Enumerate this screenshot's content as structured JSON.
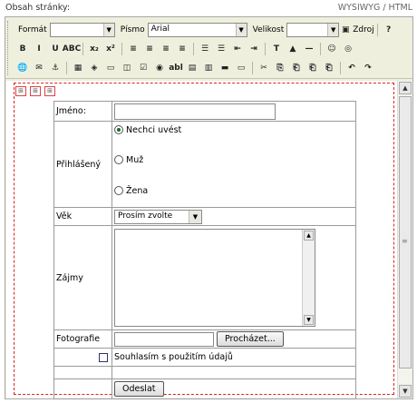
{
  "header": {
    "label": "Obsah stránky:",
    "mode": "WYSIWYG / HTML"
  },
  "toolbar": {
    "format_label": "Formát",
    "format_value": "",
    "font_label": "Písmo",
    "font_value": "Arial",
    "size_label": "Velikost",
    "size_value": "",
    "zoom_label": "Zdroj",
    "help_label": "?",
    "row2_buttons": [
      "B",
      "I",
      "U",
      "ABC",
      "x₂",
      "x²",
      "≡",
      "≡",
      "≡",
      "≡",
      "☰",
      "☰",
      "⇤",
      "⇥",
      "T",
      "▲",
      "—",
      "☺",
      "◎"
    ],
    "row3_buttons": [
      "🌐",
      "✉",
      "⚓",
      "▦",
      "◈",
      "▭",
      "◫",
      "☑",
      "◉",
      "abl",
      "▤",
      "▥",
      "▬",
      "▭",
      "✂",
      "⎘",
      "⎗",
      "⎗",
      "⎗",
      "↶",
      "↷"
    ]
  },
  "form": {
    "jmeno_label": "Jméno:",
    "prihlasen_label": "Přihlášený",
    "radio1_label": "Nechci uvést",
    "radio2_label": "Muž",
    "radio3_label": "Žena",
    "vek_label": "Věk",
    "vek_value": "Prosím zvolte",
    "zajmy_label": "Zájmy",
    "foto_label": "Fotografie",
    "browse_label": "Procházet...",
    "consent_label": "Souhlasím s použitím údajů",
    "submit_label": "Odeslat"
  }
}
